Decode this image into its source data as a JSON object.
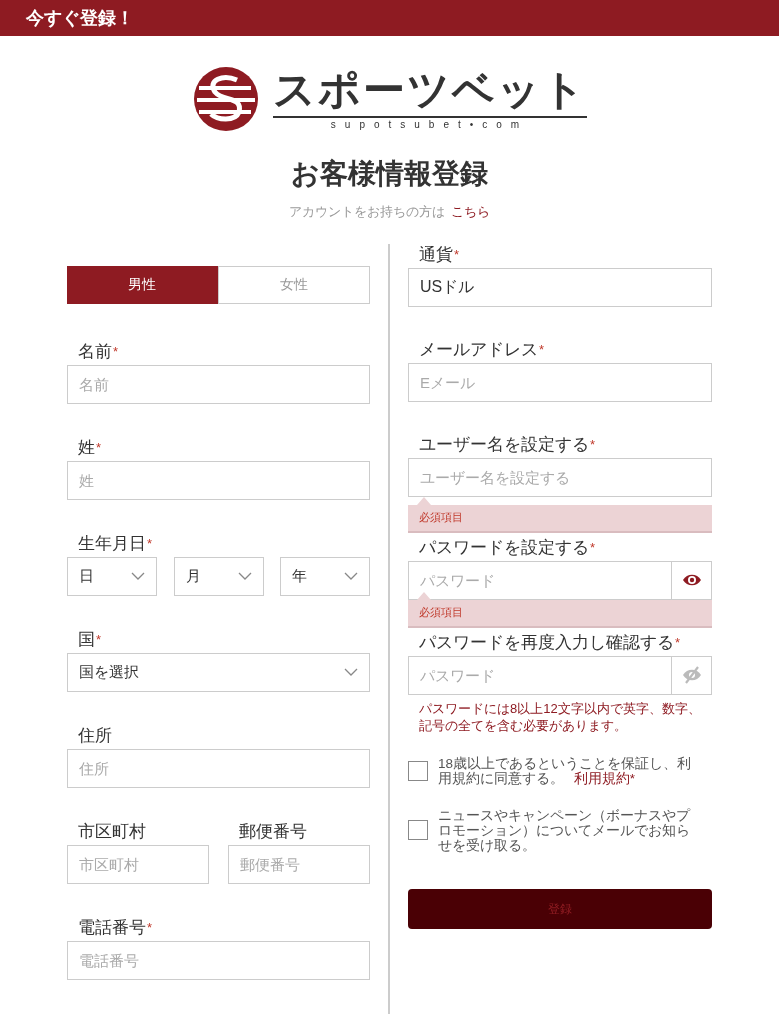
{
  "header": {
    "title": "今すぐ登録！"
  },
  "logo": {
    "name": "スポーツベット",
    "domain": "supotsubet•com"
  },
  "page_title": "お客様情報登録",
  "login_prompt": {
    "text": "アカウントをお持ちの方は",
    "link": "こちら"
  },
  "gender_tabs": [
    {
      "label": "男性",
      "selected": true
    },
    {
      "label": "女性",
      "selected": false
    }
  ],
  "left_fields": [
    {
      "kind": "text",
      "label": "名前",
      "mark": "*",
      "placeholder": "名前"
    },
    {
      "kind": "text",
      "label": "姓",
      "mark": "*",
      "placeholder": "姓"
    },
    {
      "kind": "selects",
      "label": "生年月日",
      "mark": "*",
      "options": [
        "日",
        "月",
        "年"
      ]
    },
    {
      "kind": "select",
      "label": "国",
      "mark": "*",
      "value": "国を選択"
    },
    {
      "kind": "text",
      "label": "住所",
      "placeholder": "住所"
    },
    {
      "kind": "pair",
      "items": [
        {
          "label": "市区町村",
          "placeholder": "市区町村"
        },
        {
          "label": "郵便番号",
          "placeholder": "郵便番号"
        }
      ]
    },
    {
      "kind": "text",
      "label": "電話番号",
      "mark": "*",
      "placeholder": "電話番号"
    }
  ],
  "right_fields": [
    {
      "kind": "value",
      "label": "通貨",
      "mark": "*",
      "value": "USドル"
    },
    {
      "kind": "text",
      "label": "メールアドレス",
      "mark": "*",
      "placeholder": "Eメール"
    },
    {
      "kind": "text",
      "label": "ユーザー名を設定する",
      "mark": "*",
      "placeholder": "ユーザー名を設定する",
      "error": "必須項目"
    },
    {
      "kind": "password",
      "label": "パスワードを設定する",
      "mark": "*",
      "placeholder": "パスワード",
      "visible": true,
      "error": "必須項目"
    },
    {
      "kind": "password",
      "label": "パスワードを再度入力し確認する",
      "mark": "*",
      "placeholder": "パスワード",
      "visible": false,
      "hint": "パスワードには8以上12文字以内で英字、数字、記号の全てを含む必要があります。"
    }
  ],
  "checkboxes": [
    {
      "text": "18歳以上であるということを保証し、利用規約に同意する。",
      "link": "利用規約*",
      "checked": false
    },
    {
      "text": "ニュースやキャンペーン（ボーナスやプロモーション）についてメールでお知らせを受け取る。",
      "checked": false
    }
  ],
  "submit": {
    "label": "登録",
    "disabled": true
  }
}
